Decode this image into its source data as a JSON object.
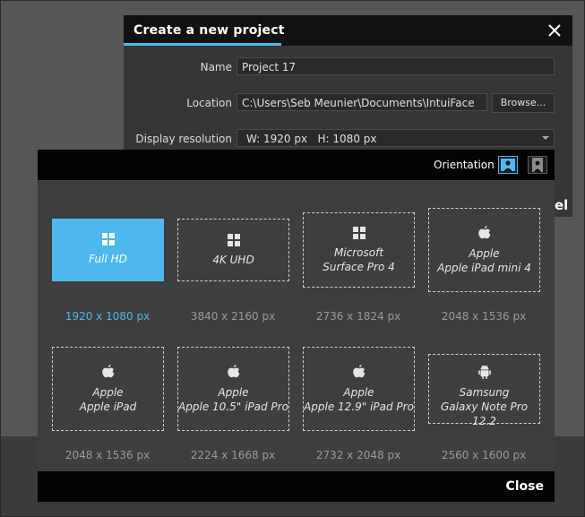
{
  "new_project_dialog": {
    "title": "Create a new project",
    "name_label": "Name",
    "name_value": "Project 17",
    "location_label": "Location",
    "location_value": "C:\\Users\\Seb Meunier\\Documents\\IntuiFace",
    "browse_label": "Browse...",
    "resolution_label": "Display resolution",
    "resolution_value": "W: 1920 px   H: 1080 px",
    "cancel_peek": "el"
  },
  "resolution_dialog": {
    "orientation_label": "Orientation",
    "close_label": "Close",
    "accent_color": "#4db8ee",
    "devices": [
      {
        "line1": "",
        "line2": "Full HD",
        "resolution": "1920 x 1080 px",
        "icon": "windows-icon"
      },
      {
        "line1": "",
        "line2": "4K UHD",
        "resolution": "3840 x 2160 px",
        "icon": "windows-icon"
      },
      {
        "line1": "Microsoft",
        "line2": "Surface Pro 4",
        "resolution": "2736 x 1824 px",
        "icon": "windows-icon"
      },
      {
        "line1": "Apple",
        "line2": "Apple iPad mini 4",
        "resolution": "2048 x 1536 px",
        "icon": "apple-icon"
      },
      {
        "line1": "Apple",
        "line2": "Apple iPad",
        "resolution": "2048 x 1536 px",
        "icon": "apple-icon"
      },
      {
        "line1": "Apple",
        "line2": "Apple 10.5\" iPad Pro",
        "resolution": "2224 x 1668 px",
        "icon": "apple-icon"
      },
      {
        "line1": "Apple",
        "line2": "Apple 12.9\" iPad Pro",
        "resolution": "2732 x 2048 px",
        "icon": "apple-icon"
      },
      {
        "line1": "Samsung",
        "line2": "Galaxy Note Pro 12.2",
        "resolution": "2560 x 1600 px",
        "icon": "android-icon"
      }
    ]
  }
}
